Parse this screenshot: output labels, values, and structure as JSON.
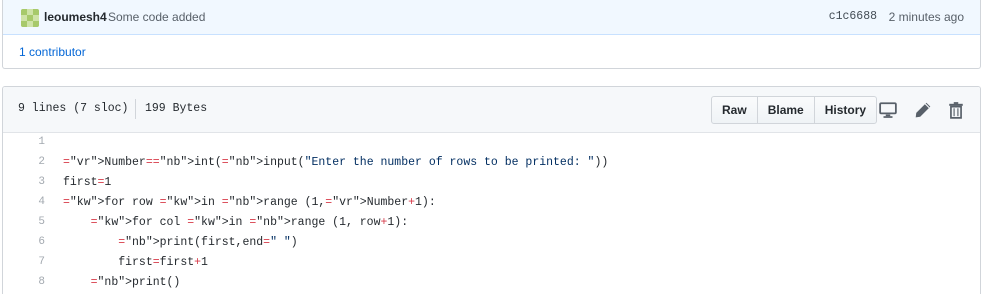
{
  "commit": {
    "author": "leoumesh4",
    "message": "Some code added",
    "sha": "c1c6688",
    "age": "2 minutes ago",
    "contributors": "1 contributor"
  },
  "file": {
    "lines_info": "9 lines (7 sloc)",
    "size": "199 Bytes",
    "buttons": {
      "raw": "Raw",
      "blame": "Blame",
      "history": "History"
    }
  },
  "code": {
    "line_numbers": [
      "1",
      "2",
      "3",
      "4",
      "5",
      "6",
      "7",
      "8"
    ],
    "lines": [
      "",
      "Number=int(input(\"Enter the number of rows to be printed: \"))",
      "first=1",
      "for row in range (1,Number+1):",
      "    for col in range (1, row+1):",
      "        print(first,end=\" \")",
      "        first=first+1",
      "    print()"
    ]
  },
  "colors": {
    "accent": "#0366d6",
    "header_bg": "#f1f8ff",
    "file_header_bg": "#f6f8fa"
  },
  "icons": [
    "desktop-icon",
    "pencil-icon",
    "trash-icon"
  ]
}
